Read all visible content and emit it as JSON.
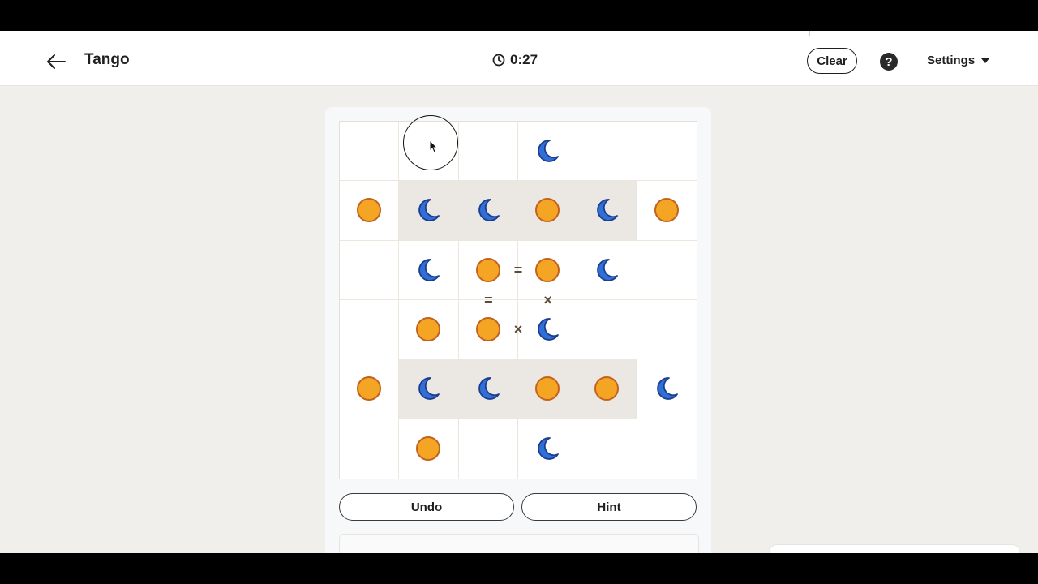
{
  "header": {
    "title": "Tango",
    "timer": "0:27",
    "clear_label": "Clear",
    "help_label": "?",
    "settings_label": "Settings",
    "icons": {
      "back": "arrow-left-icon",
      "timer": "clock-icon",
      "help": "question-icon",
      "settings": "caret-down-icon"
    }
  },
  "board": {
    "size": 6,
    "colors": {
      "sun": "#f5a524",
      "sun_border": "#c3611e",
      "moon": "#2f6fd6",
      "moon_border": "#1d3d8f",
      "shaded": "#ebe8e4"
    },
    "cells": [
      [
        "",
        "",
        "",
        "moon",
        "",
        ""
      ],
      [
        "sun",
        "moon",
        "moon",
        "sun",
        "moon",
        "sun"
      ],
      [
        "",
        "moon",
        "sun",
        "sun",
        "moon",
        ""
      ],
      [
        "",
        "sun",
        "sun",
        "moon",
        "",
        ""
      ],
      [
        "sun",
        "moon",
        "moon",
        "sun",
        "sun",
        "moon"
      ],
      [
        "",
        "sun",
        "",
        "moon",
        "",
        ""
      ]
    ],
    "shaded_cells": [
      [
        1,
        1
      ],
      [
        1,
        2
      ],
      [
        1,
        3
      ],
      [
        1,
        4
      ],
      [
        4,
        1
      ],
      [
        4,
        2
      ],
      [
        4,
        3
      ],
      [
        4,
        4
      ]
    ],
    "constraints": [
      {
        "between": [
          [
            2,
            2
          ],
          [
            2,
            3
          ]
        ],
        "symbol": "="
      },
      {
        "between": [
          [
            2,
            2
          ],
          [
            3,
            2
          ]
        ],
        "symbol": "="
      },
      {
        "between": [
          [
            2,
            3
          ],
          [
            3,
            3
          ]
        ],
        "symbol": "×"
      },
      {
        "between": [
          [
            3,
            2
          ],
          [
            3,
            3
          ]
        ],
        "symbol": "×"
      }
    ]
  },
  "actions": {
    "undo_label": "Undo",
    "hint_label": "Hint"
  }
}
